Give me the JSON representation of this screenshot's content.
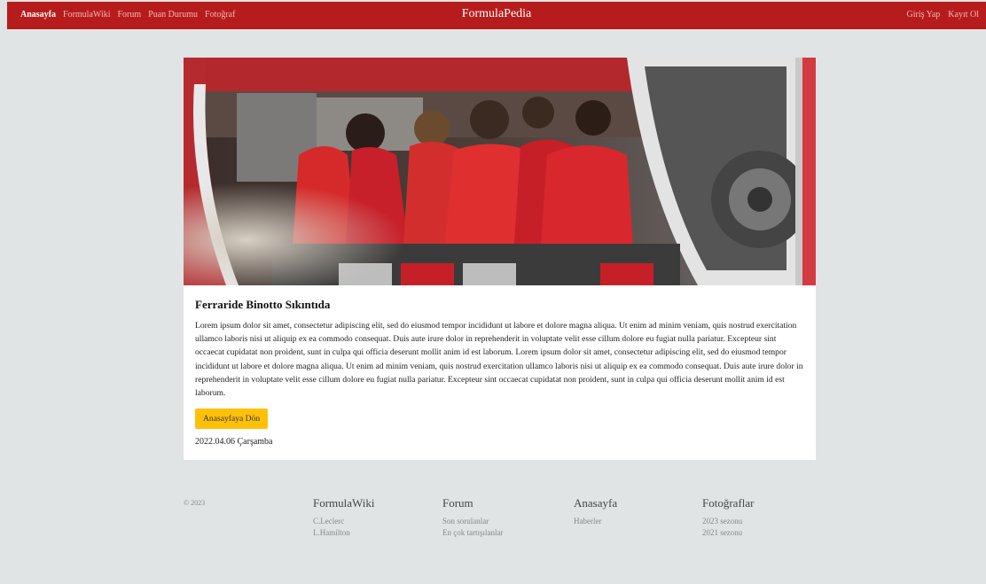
{
  "navbar": {
    "links": [
      "Anasayfa",
      "FormulaWiki",
      "Forum",
      "Puan Durumu",
      "Fotoğraf"
    ],
    "brand": "FormulaPedia",
    "right": [
      "Giriş Yap",
      "Kayıt Ol"
    ]
  },
  "article": {
    "title": "Ferraride Binotto Sıkıntıda",
    "text": "Lorem ipsum dolor sit amet, consectetur adipiscing elit, sed do eiusmod tempor incididunt ut labore et dolore magna aliqua. Ut enim ad minim veniam, quis nostrud exercitation ullamco laboris nisi ut aliquip ex ea commodo consequat. Duis aute irure dolor in reprehenderit in voluptate velit esse cillum dolore eu fugiat nulla pariatur. Excepteur sint occaecat cupidatat non proident, sunt in culpa qui officia deserunt mollit anim id est laborum. Lorem ipsum dolor sit amet, consectetur adipiscing elit, sed do eiusmod tempor incididunt ut labore et dolore magna aliqua. Ut enim ad minim veniam, quis nostrud exercitation ullamco laboris nisi ut aliquip ex ea commodo consequat. Duis aute irure dolor in reprehenderit in voluptate velit esse cillum dolore eu fugiat nulla pariatur. Excepteur sint occaecat cupidatat non proident, sunt in culpa qui officia deserunt mollit anim id est laborum.",
    "button": "Anasayfaya Dön",
    "date": "2022.04.06 Çarşamba"
  },
  "footer": {
    "copyright": "© 2023",
    "columns": [
      {
        "title": "FormulaWiki",
        "links": [
          "C.Leclerc",
          "L.Hamilton"
        ]
      },
      {
        "title": "Forum",
        "links": [
          "Son sorulanlar",
          "En çok tartışılanlar"
        ]
      },
      {
        "title": "Anasayfa",
        "links": [
          "Haberler"
        ]
      },
      {
        "title": "Fotoğraflar",
        "links": [
          "2023 sezonu",
          "2021 sezonu"
        ]
      }
    ]
  },
  "colors": {
    "navbar": "#b71c1c",
    "button": "#ffc107",
    "background": "#e1e4e4"
  }
}
